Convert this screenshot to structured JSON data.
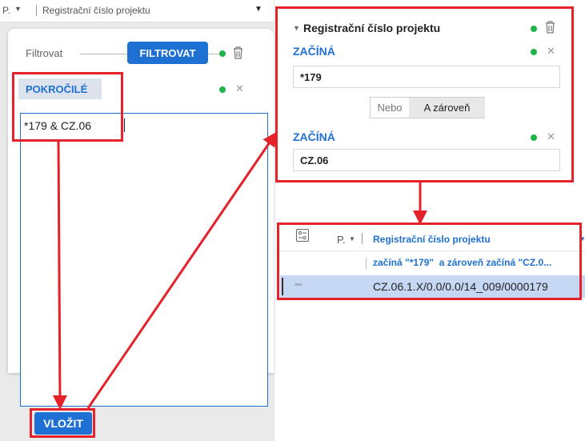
{
  "left": {
    "header": {
      "col_short": "P.",
      "col_title": "Registrační číslo projektu"
    },
    "filter": {
      "label": "Filtrovat",
      "button": "FILTROVAT"
    },
    "advanced": {
      "tab": "POKROČILÉ",
      "text": "*179 & CZ.06"
    },
    "insert_button": "VLOŽIT"
  },
  "right_panel": {
    "title": "Registrační číslo projektu",
    "cond1": {
      "op": "ZAČÍNÁ",
      "value": "*179"
    },
    "logic": {
      "or": "Nebo",
      "and": "A zároveň"
    },
    "cond2": {
      "op": "ZAČÍNÁ",
      "value": "CZ.06"
    }
  },
  "table": {
    "col_short": "P.",
    "col_title": "Registrační číslo projektu",
    "filter_summary": "začíná \"*179\"  a zároveň začíná \"CZ.0...",
    "row_dots": "◦◦◦",
    "row_value": "CZ.06.1.X/0.0/0.0/14_009/0000179"
  },
  "colors": {
    "accent": "#1e70d2",
    "highlight": "#e52129",
    "status": "#1fb34a",
    "selected_row": "#c5d7f2"
  }
}
